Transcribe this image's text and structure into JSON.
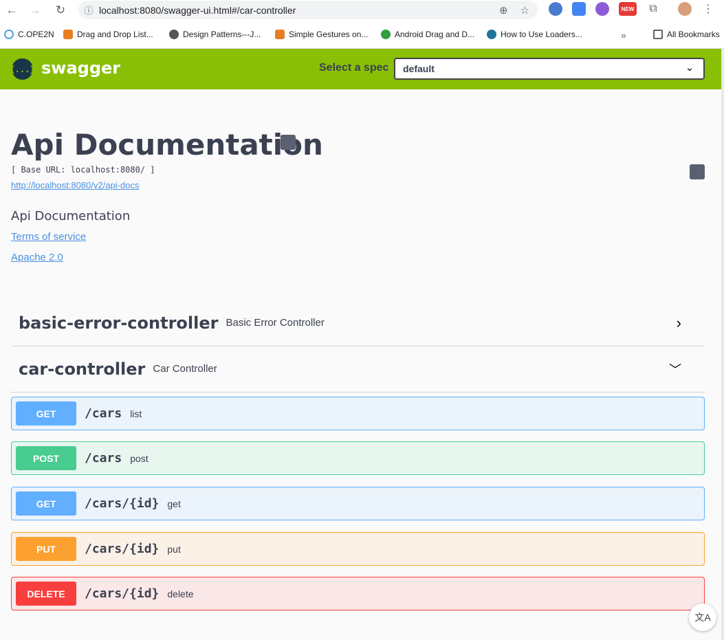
{
  "browser": {
    "url": "localhost:8080/swagger-ui.html#/car-controller",
    "bookmarks": [
      "C.OPE2N",
      "Drag and Drop List...",
      "Design Patterns---J...",
      "Simple Gestures on...",
      "Android Drag and D...",
      "How to Use Loaders...",
      "All Bookmarks"
    ],
    "ext_new_badge": "NEW"
  },
  "header": {
    "brand": "swagger",
    "logo_glyph": "{...}",
    "spec_label": "Select a spec",
    "spec_value": "default"
  },
  "info": {
    "title": "Api Documentation",
    "base_url": "[ Base URL: localhost:8080/ ]",
    "api_docs_link": "http://localhost:8080/v2/api-docs",
    "description": "Api Documentation",
    "terms": "Terms of service",
    "license": "Apache 2.0"
  },
  "tags": [
    {
      "name": "basic-error-controller",
      "description": "Basic Error Controller",
      "expanded": false
    },
    {
      "name": "car-controller",
      "description": "Car Controller",
      "expanded": true
    }
  ],
  "operations": [
    {
      "method": "GET",
      "path": "/cars",
      "summary": "list"
    },
    {
      "method": "POST",
      "path": "/cars",
      "summary": "post"
    },
    {
      "method": "GET",
      "path": "/cars/{id}",
      "summary": "get"
    },
    {
      "method": "PUT",
      "path": "/cars/{id}",
      "summary": "put"
    },
    {
      "method": "DELETE",
      "path": "/cars/{id}",
      "summary": "delete"
    }
  ],
  "colors": {
    "header_green": "#89bf04",
    "get": "#61affe",
    "post": "#49cc90",
    "put": "#fca130",
    "delete": "#f93e3e"
  }
}
